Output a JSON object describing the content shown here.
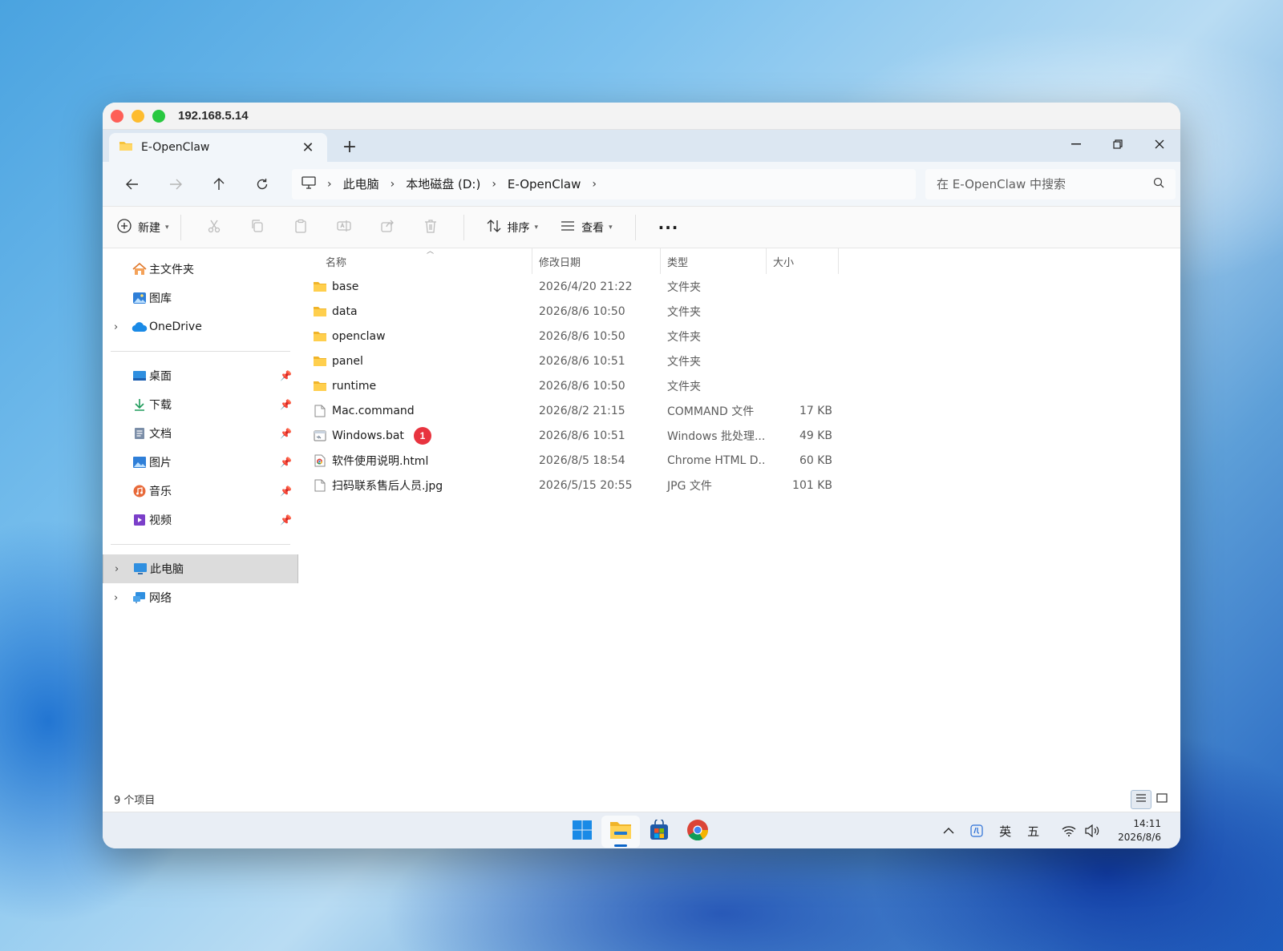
{
  "window": {
    "title": "192.168.5.14"
  },
  "tab": {
    "label": "E-OpenClaw",
    "close": "✕",
    "new": "+"
  },
  "window_controls": {
    "minimize": "—",
    "restore": "❐",
    "close": "✕"
  },
  "address": {
    "crumbs": [
      "此电脑",
      "本地磁盘 (D:)",
      "E-OpenClaw"
    ]
  },
  "search": {
    "placeholder": "在 E-OpenClaw 中搜索"
  },
  "toolbar": {
    "new_label": "新建",
    "sort_label": "排序",
    "view_label": "查看",
    "more_label": "···"
  },
  "nav": {
    "quick": [
      {
        "label": "主文件夹",
        "icon": "home-icon"
      },
      {
        "label": "图库",
        "icon": "gallery-icon"
      },
      {
        "label": "OneDrive",
        "icon": "onedrive-icon"
      }
    ],
    "pinned": [
      {
        "label": "桌面",
        "icon": "desktop-icon"
      },
      {
        "label": "下载",
        "icon": "download-icon"
      },
      {
        "label": "文档",
        "icon": "documents-icon"
      },
      {
        "label": "图片",
        "icon": "pictures-icon"
      },
      {
        "label": "音乐",
        "icon": "music-icon"
      },
      {
        "label": "视频",
        "icon": "videos-icon"
      }
    ],
    "devices": [
      {
        "label": "此电脑",
        "icon": "this-pc-icon"
      },
      {
        "label": "网络",
        "icon": "network-icon"
      }
    ]
  },
  "columns": {
    "name": "名称",
    "date": "修改日期",
    "type": "类型",
    "size": "大小"
  },
  "files": [
    {
      "name": "base",
      "date": "2026/4/20 21:22",
      "type": "文件夹",
      "size": "",
      "icon": "folder-icon"
    },
    {
      "name": "data",
      "date": "2026/8/6 10:50",
      "type": "文件夹",
      "size": "",
      "icon": "folder-icon"
    },
    {
      "name": "openclaw",
      "date": "2026/8/6 10:50",
      "type": "文件夹",
      "size": "",
      "icon": "folder-icon"
    },
    {
      "name": "panel",
      "date": "2026/8/6 10:51",
      "type": "文件夹",
      "size": "",
      "icon": "folder-icon"
    },
    {
      "name": "runtime",
      "date": "2026/8/6 10:50",
      "type": "文件夹",
      "size": "",
      "icon": "folder-icon"
    },
    {
      "name": "Mac.command",
      "date": "2026/8/2 21:15",
      "type": "COMMAND 文件",
      "size": "17 KB",
      "icon": "file-icon"
    },
    {
      "name": "Windows.bat",
      "date": "2026/8/6 10:51",
      "type": "Windows 批处理...",
      "size": "49 KB",
      "icon": "batch-file-icon",
      "badge": "1"
    },
    {
      "name": "软件使用说明.html",
      "date": "2026/8/5 18:54",
      "type": "Chrome HTML D...",
      "size": "60 KB",
      "icon": "chrome-html-icon"
    },
    {
      "name": "扫码联系售后人员.jpg",
      "date": "2026/5/15 20:55",
      "type": "JPG 文件",
      "size": "101 KB",
      "icon": "file-icon"
    }
  ],
  "status": {
    "count": "9 个项目"
  },
  "taskbar": {
    "apps": [
      "windows-start-icon",
      "file-explorer-icon",
      "store-icon",
      "chrome-icon"
    ],
    "tray": {
      "chevron": "^",
      "ime_mode": "英",
      "ime_name": "五",
      "time": "14:11",
      "date": "2026/8/6"
    }
  },
  "colors": {
    "badge": "#e8343f",
    "folder": "#f6c33c",
    "accent": "#0a64c8"
  }
}
